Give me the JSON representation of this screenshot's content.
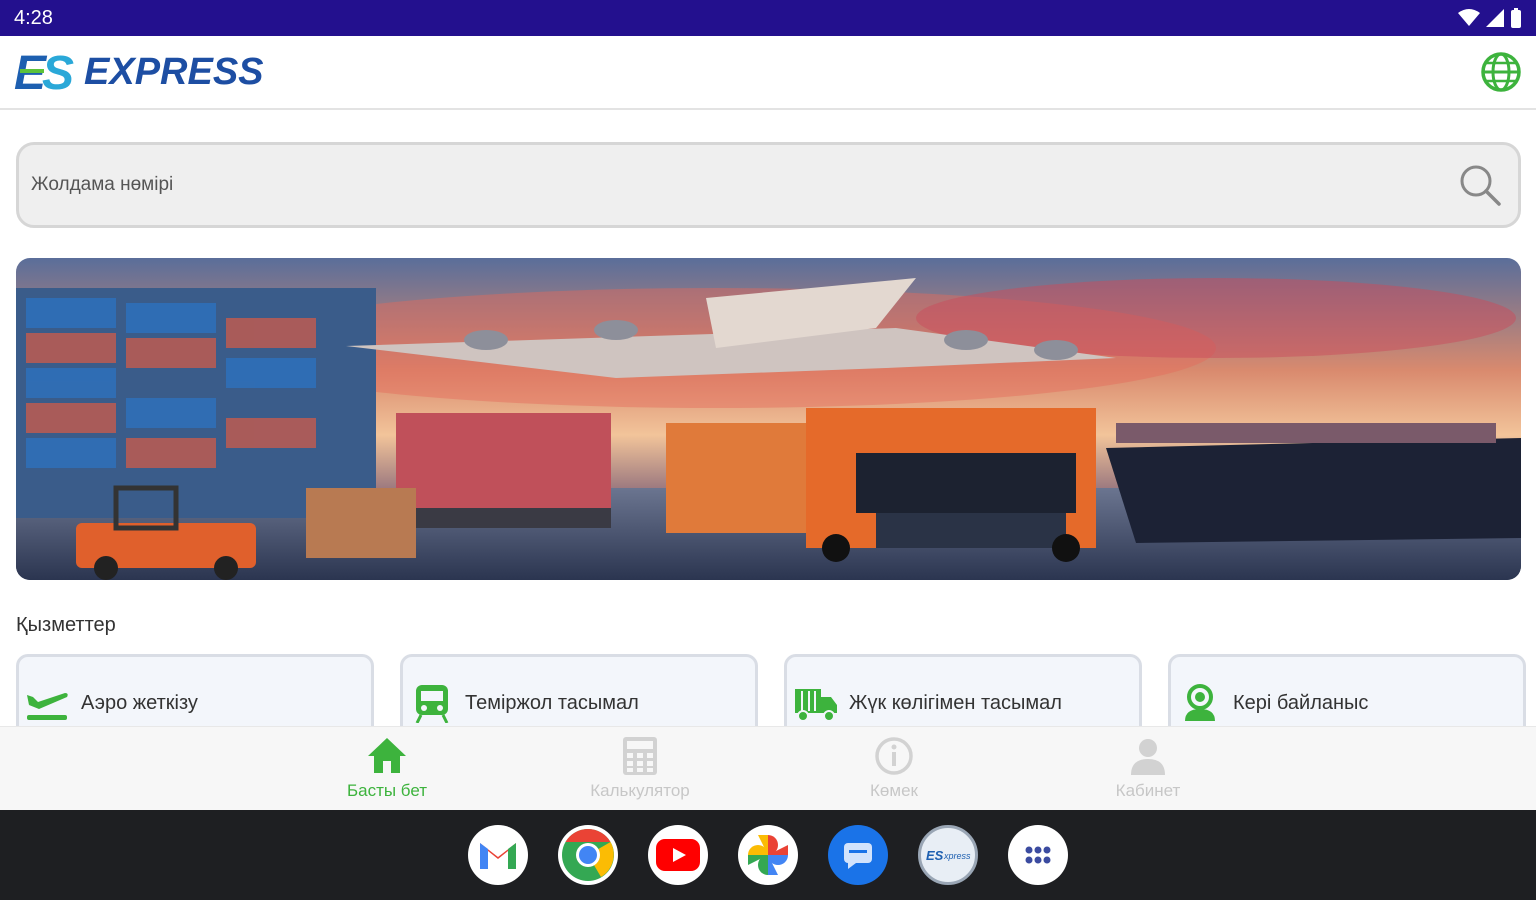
{
  "status_bar": {
    "time": "4:28"
  },
  "header": {
    "logo_mark": "ES",
    "logo_text": "EXPRESS",
    "language_icon": "globe-icon"
  },
  "search": {
    "placeholder": "Жолдама нөмірі",
    "icon": "search-icon"
  },
  "banner": {
    "description_icon": "logistics-banner"
  },
  "services": {
    "title": "Қызметтер",
    "items": [
      {
        "label": "Аэро жеткізу",
        "icon": "airplane-icon"
      },
      {
        "label": "Теміржол тасымал",
        "icon": "train-icon"
      },
      {
        "label": "Жүк көлігімен тасымал",
        "icon": "truck-icon"
      },
      {
        "label": "Кері байланыс",
        "icon": "support-icon"
      }
    ]
  },
  "bottom_nav": {
    "items": [
      {
        "label": "Басты бет",
        "icon": "home-icon",
        "active": true
      },
      {
        "label": "Калькулятор",
        "icon": "calculator-icon",
        "active": false
      },
      {
        "label": "Көмек",
        "icon": "info-icon",
        "active": false
      },
      {
        "label": "Кабинет",
        "icon": "user-icon",
        "active": false
      }
    ]
  },
  "dock": {
    "apps": [
      "gmail-icon",
      "chrome-icon",
      "youtube-icon",
      "photos-icon",
      "messages-icon",
      "es-express-app-icon",
      "app-drawer-icon"
    ]
  },
  "colors": {
    "status_bar": "#23108e",
    "accent_green": "#3db33d",
    "brand_blue": "#1d5fb0"
  }
}
